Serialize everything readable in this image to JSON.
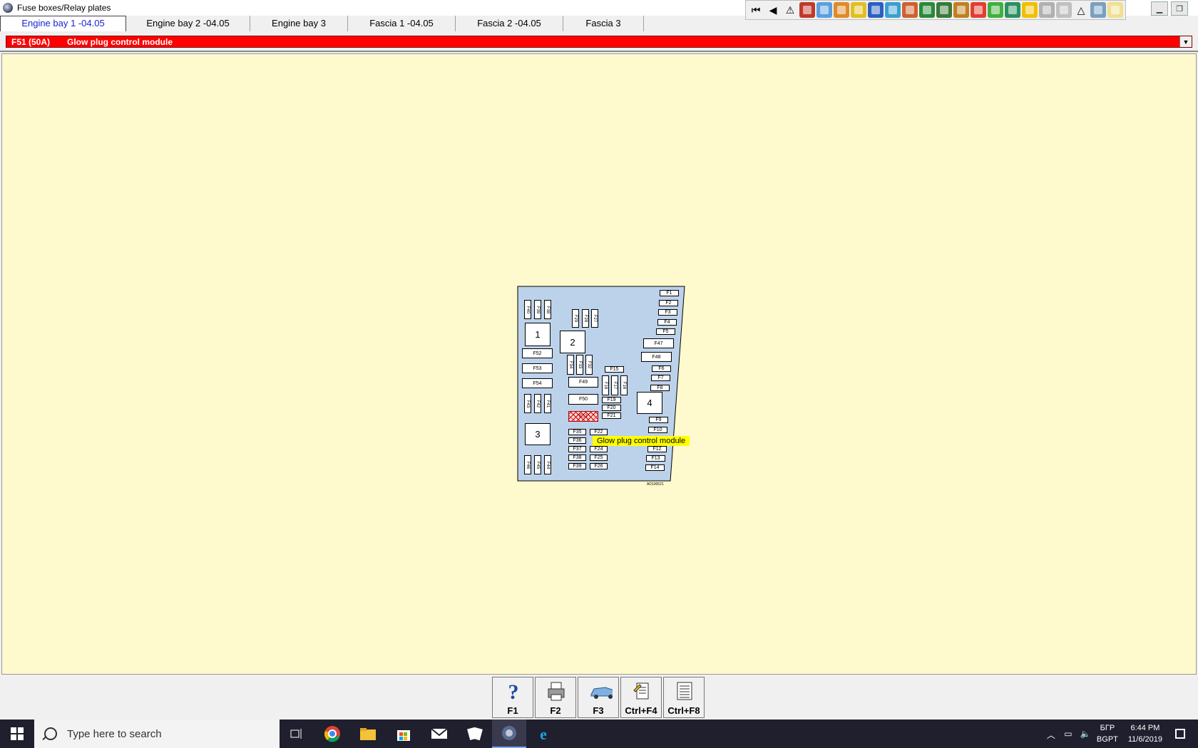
{
  "window": {
    "title": "Fuse boxes/Relay plates"
  },
  "tabs": [
    {
      "label": "Engine bay 1 -04.05",
      "active": true
    },
    {
      "label": "Engine bay 2 -04.05",
      "active": false
    },
    {
      "label": "Engine bay 3",
      "active": false
    },
    {
      "label": "Fascia 1 -04.05",
      "active": false
    },
    {
      "label": "Fascia 2 -04.05",
      "active": false
    },
    {
      "label": "Fascia 3",
      "active": false
    }
  ],
  "toolbar": {
    "icons": [
      "first-page-icon",
      "prev-page-icon",
      "warning-icon",
      "flag-icon",
      "engine-icon",
      "settings-icon",
      "tools-icon",
      "gauge-icon",
      "wiring-icon",
      "car-icon",
      "door-icon",
      "diagram-icon",
      "pen-icon",
      "smile-icon",
      "battery-icon",
      "sensor-icon",
      "light-icon",
      "spray-icon",
      "lamp-icon",
      "triangle-icon",
      "check-icon",
      "note-icon"
    ],
    "colors": [
      "#f0f0f0",
      "#f0f0f0",
      "#f0f0f0",
      "#c0392b",
      "#5aa0e0",
      "#e08a2a",
      "#e0c020",
      "#2e5fc0",
      "#3aa0d0",
      "#d06030",
      "#2a8a3a",
      "#3a7a3a",
      "#c08020",
      "#e04030",
      "#40b040",
      "#2a9060",
      "#f0c000",
      "#b0b0b0",
      "#c0c0c0",
      "#9a9a9a",
      "#7aa0c0",
      "#f0e090"
    ]
  },
  "window_buttons": {
    "minimize": "▁",
    "restore": "❐",
    "close": "✕"
  },
  "selector": {
    "code": "F51 (50A)",
    "description": "Glow plug control module",
    "dropdown": "▼"
  },
  "diagram": {
    "relays": [
      "1",
      "2",
      "3",
      "4"
    ],
    "fuses": [
      "F1",
      "F2",
      "F3",
      "F4",
      "F5",
      "F47",
      "F48",
      "F6",
      "F7",
      "F8",
      "F9",
      "F10",
      "F12",
      "F13",
      "F14",
      "F15",
      "F16",
      "F17",
      "F18",
      "F19",
      "F20",
      "F21",
      "F22",
      "F24",
      "F25",
      "F26",
      "F27",
      "F28",
      "F29",
      "F30",
      "F31",
      "F32",
      "F33",
      "F34",
      "F35",
      "F36",
      "F37",
      "F38",
      "F39",
      "F40",
      "F41",
      "F42",
      "F43",
      "F44",
      "F45",
      "F46",
      "F49",
      "F50",
      "F51",
      "F52",
      "F53",
      "F54"
    ],
    "highlighted": "F51",
    "reference": "AD100521",
    "tooltip": "Glow plug control module"
  },
  "function_keys": [
    {
      "label": "F1",
      "icon": "help-icon"
    },
    {
      "label": "F2",
      "icon": "print-icon"
    },
    {
      "label": "F3",
      "icon": "car-diagram-icon"
    },
    {
      "label": "Ctrl+F4",
      "icon": "notes-icon"
    },
    {
      "label": "Ctrl+F8",
      "icon": "list-icon"
    }
  ],
  "taskbar": {
    "search_placeholder": "Type here to search",
    "language_top": "БГР",
    "language_bottom": "BGPT",
    "time": "6:44 PM",
    "date": "11/6/2019"
  }
}
